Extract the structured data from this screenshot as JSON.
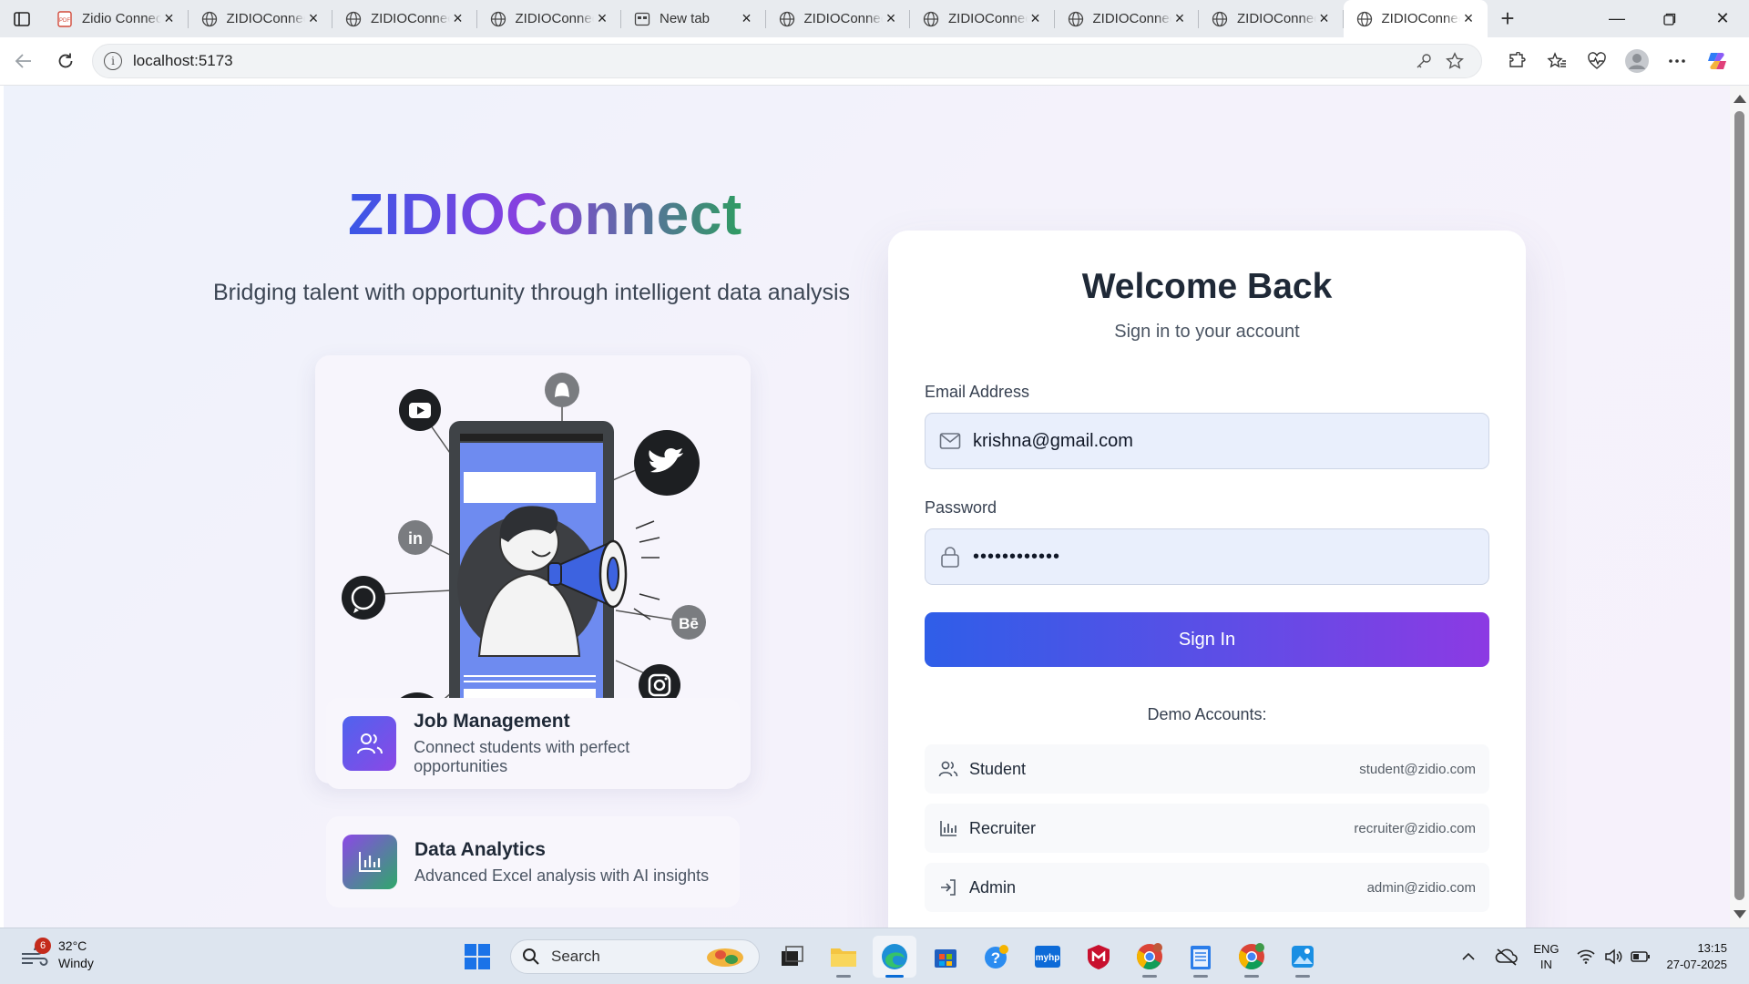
{
  "browser": {
    "tabs": [
      {
        "title": "Zidio Connect",
        "favicon": "pdf-icon",
        "active": false
      },
      {
        "title": "ZIDIOConnect",
        "favicon": "globe-icon",
        "active": false
      },
      {
        "title": "ZIDIOConnect",
        "favicon": "globe-icon",
        "active": false
      },
      {
        "title": "ZIDIOConnect",
        "favicon": "globe-icon",
        "active": false
      },
      {
        "title": "New tab",
        "favicon": "newtab-icon",
        "active": false
      },
      {
        "title": "ZIDIOConnect",
        "favicon": "globe-icon",
        "active": false
      },
      {
        "title": "ZIDIOConnect",
        "favicon": "globe-icon",
        "active": false
      },
      {
        "title": "ZIDIOConnect",
        "favicon": "globe-icon",
        "active": false
      },
      {
        "title": "ZIDIOConnect",
        "favicon": "globe-icon",
        "active": false
      },
      {
        "title": "ZIDIOConnect",
        "favicon": "globe-icon",
        "active": true
      }
    ],
    "url": "localhost:5173"
  },
  "hero": {
    "brand": "ZIDIOConnect",
    "tagline": "Bridging talent with opportunity through intelligent data analysis"
  },
  "features": [
    {
      "title": "Job Management",
      "description": "Connect students with perfect opportunities",
      "icon": "users-icon"
    },
    {
      "title": "Data Analytics",
      "description": "Advanced Excel analysis with AI insights",
      "icon": "bar-chart-icon"
    }
  ],
  "login": {
    "title": "Welcome Back",
    "subtitle": "Sign in to your account",
    "email_label": "Email Address",
    "email_value": "krishna@gmail.com",
    "password_label": "Password",
    "password_value": "••••••••••••",
    "submit_label": "Sign In",
    "demo_title": "Demo Accounts:",
    "demo_accounts": [
      {
        "role": "Student",
        "email": "student@zidio.com",
        "icon": "users-icon"
      },
      {
        "role": "Recruiter",
        "email": "recruiter@zidio.com",
        "icon": "bar-chart-icon"
      },
      {
        "role": "Admin",
        "email": "admin@zidio.com",
        "icon": "login-icon"
      }
    ]
  },
  "taskbar": {
    "weather_temp": "32°C",
    "weather_desc": "Windy",
    "weather_badge": "6",
    "search_placeholder": "Search",
    "lang_line1": "ENG",
    "lang_line2": "IN",
    "time": "13:15",
    "date": "27-07-2025"
  },
  "colors": {
    "brand_blue": "#3a57e6",
    "brand_purple": "#8a3fe0",
    "brand_green": "#2f9c62",
    "button_start": "#2f5ee8",
    "button_end": "#8c3ae3"
  }
}
